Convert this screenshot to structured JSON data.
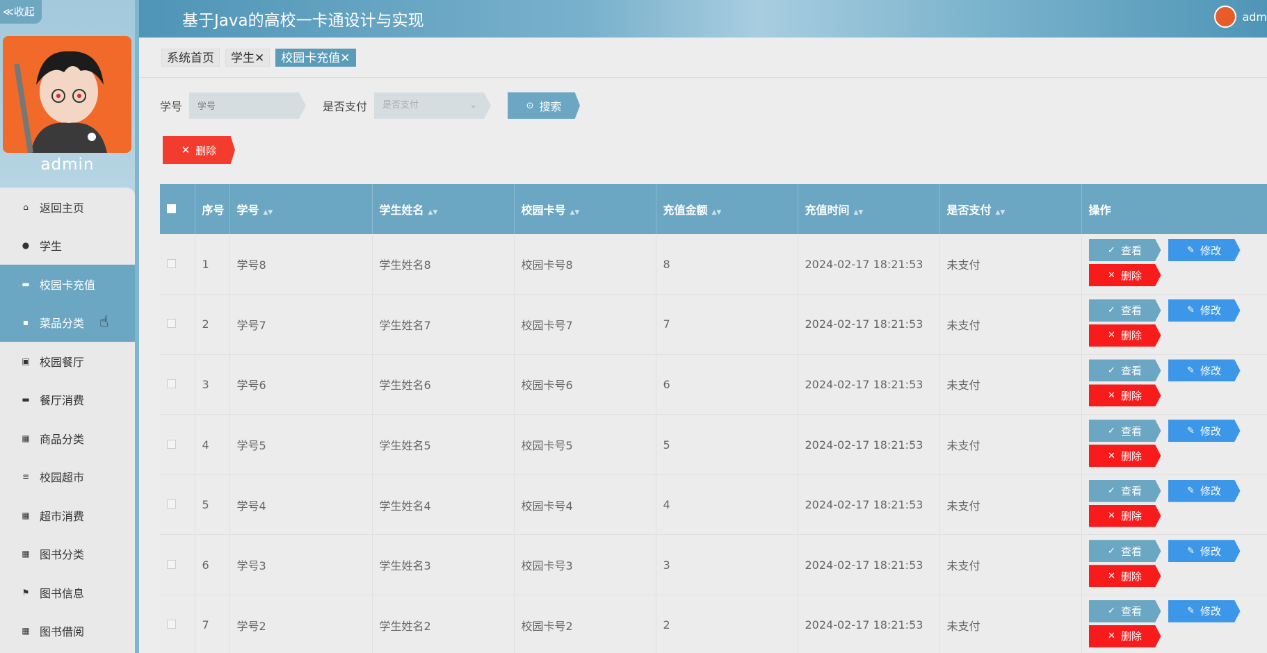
{
  "sidebar": {
    "collapse_label": "≪收起",
    "admin_name": "admin",
    "menu": [
      {
        "label": "返回主页",
        "icon": "home-icon"
      },
      {
        "label": "学生",
        "icon": "user-icon"
      },
      {
        "label": "校园卡充值",
        "icon": "card-icon"
      },
      {
        "label": "菜品分类",
        "icon": "comment-icon"
      },
      {
        "label": "校园餐厅",
        "icon": "clipboard-icon"
      },
      {
        "label": "餐厅消费",
        "icon": "monitor-icon"
      },
      {
        "label": "商品分类",
        "icon": "grid-icon"
      },
      {
        "label": "校园超市",
        "icon": "list-icon"
      },
      {
        "label": "超市消费",
        "icon": "grid-icon"
      },
      {
        "label": "图书分类",
        "icon": "grid-icon"
      },
      {
        "label": "图书信息",
        "icon": "flag-icon"
      },
      {
        "label": "图书借阅",
        "icon": "grid-icon"
      }
    ]
  },
  "header": {
    "title": "基于Java的高校一卡通设计与实现",
    "username": "adm"
  },
  "tabs": [
    {
      "label": "系统首页",
      "closable": false
    },
    {
      "label": "学生",
      "closable": true
    },
    {
      "label": "校园卡充值",
      "closable": true
    }
  ],
  "search": {
    "student_no_label": "学号",
    "student_no_placeholder": "学号",
    "paid_label": "是否支付",
    "paid_placeholder": "是否支付",
    "search_button": "搜索"
  },
  "bulk_delete_label": "删除",
  "table": {
    "headers": [
      "序号",
      "学号",
      "学生姓名",
      "校园卡号",
      "充值金额",
      "充值时间",
      "是否支付",
      "操作"
    ],
    "rows": [
      {
        "index": "1",
        "student_no": "学号8",
        "name": "学生姓名8",
        "card_no": "校园卡号8",
        "amount": "8",
        "time": "2024-02-17 18:21:53",
        "paid": "未支付"
      },
      {
        "index": "2",
        "student_no": "学号7",
        "name": "学生姓名7",
        "card_no": "校园卡号7",
        "amount": "7",
        "time": "2024-02-17 18:21:53",
        "paid": "未支付"
      },
      {
        "index": "3",
        "student_no": "学号6",
        "name": "学生姓名6",
        "card_no": "校园卡号6",
        "amount": "6",
        "time": "2024-02-17 18:21:53",
        "paid": "未支付"
      },
      {
        "index": "4",
        "student_no": "学号5",
        "name": "学生姓名5",
        "card_no": "校园卡号5",
        "amount": "5",
        "time": "2024-02-17 18:21:53",
        "paid": "未支付"
      },
      {
        "index": "5",
        "student_no": "学号4",
        "name": "学生姓名4",
        "card_no": "校园卡号4",
        "amount": "4",
        "time": "2024-02-17 18:21:53",
        "paid": "未支付"
      },
      {
        "index": "6",
        "student_no": "学号3",
        "name": "学生姓名3",
        "card_no": "校园卡号3",
        "amount": "3",
        "time": "2024-02-17 18:21:53",
        "paid": "未支付"
      },
      {
        "index": "7",
        "student_no": "学号2",
        "name": "学生姓名2",
        "card_no": "校园卡号2",
        "amount": "2",
        "time": "2024-02-17 18:21:53",
        "paid": "未支付"
      }
    ],
    "actions": {
      "view": "查看",
      "edit": "修改",
      "delete": "删除"
    }
  },
  "colors": {
    "primary": "#6ba7c2",
    "edit": "#3d97e8",
    "danger": "#f71b1b"
  }
}
